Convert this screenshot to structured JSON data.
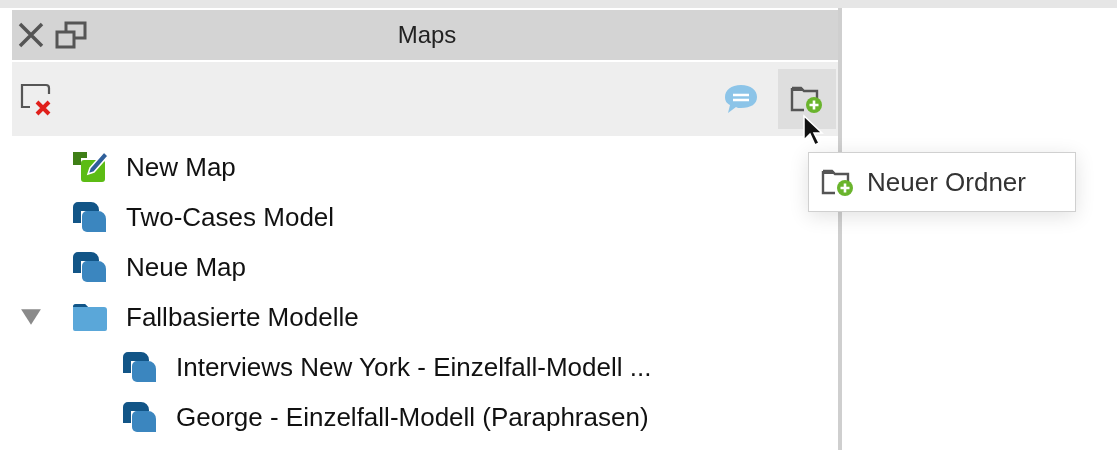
{
  "panel": {
    "title": "Maps"
  },
  "toolbar": [
    {
      "kind": "delete",
      "hovered": false
    },
    {
      "kind": "comment",
      "hovered": false
    },
    {
      "kind": "new-folder",
      "hovered": true
    }
  ],
  "tooltip": {
    "kind": "new-folder",
    "label": "Neuer Ordner"
  },
  "tree": [
    {
      "kind": "new-map",
      "label": "New Map"
    },
    {
      "kind": "map",
      "label": "Two-Cases Model"
    },
    {
      "kind": "map",
      "label": "Neue Map"
    },
    {
      "kind": "folder",
      "label": "Fallbasierte Modelle",
      "expanded": true,
      "children": [
        {
          "kind": "map",
          "label": "Interviews New York - Einzelfall-Modell ..."
        },
        {
          "kind": "map",
          "label": "George - Einzelfall-Modell (Paraphrasen)"
        }
      ]
    }
  ]
}
